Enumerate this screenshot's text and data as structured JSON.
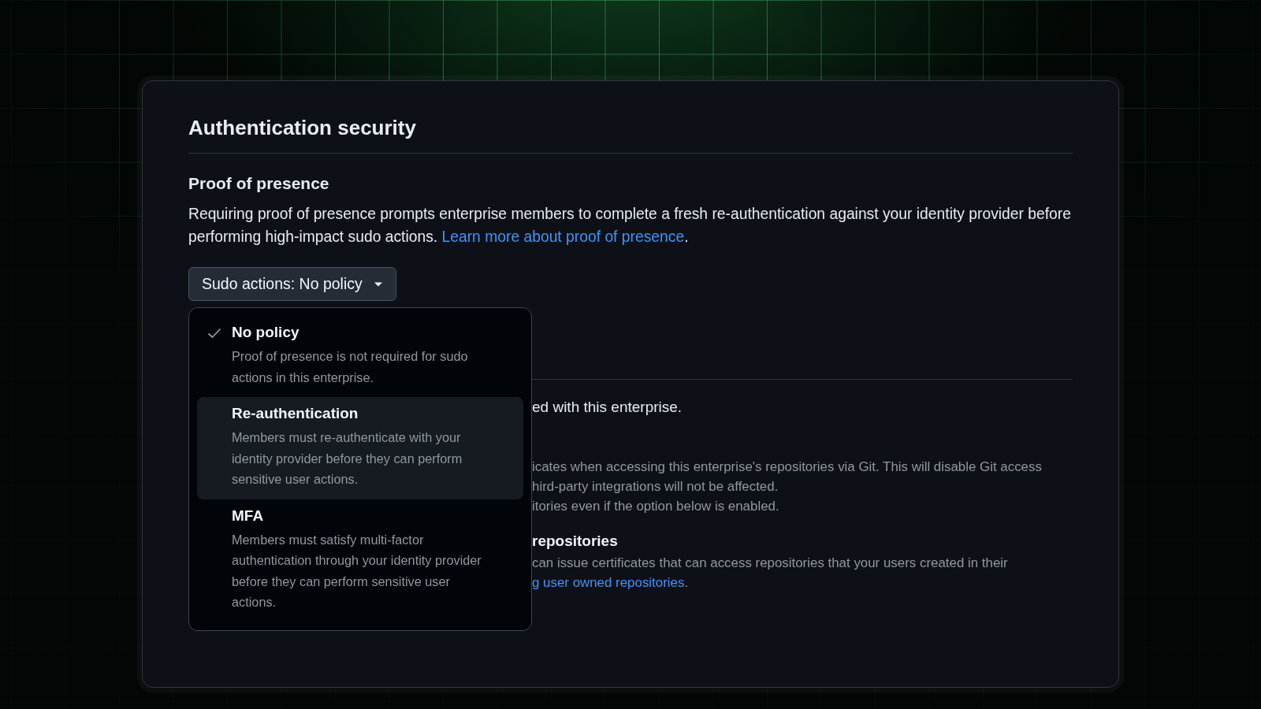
{
  "card": {
    "title": "Authentication security"
  },
  "proof_of_presence": {
    "heading": "Proof of presence",
    "description": "Requiring proof of presence prompts enterprise members to complete a fresh re-authentication against your identity provider before performing high-impact sudo actions.",
    "link": "Learn more about proof of presence",
    "link_suffix": ".",
    "dropdown": {
      "label": "Sudo actions: No policy",
      "expanded": true
    }
  },
  "menu": [
    {
      "title": "No policy",
      "description": "Proof of presence is not required for sudo actions in this enterprise.",
      "selected": true,
      "highlighted": false
    },
    {
      "title": "Re-authentication",
      "description": "Members must re-authenticate with your identity provider before they can perform sensitive user actions.",
      "selected": false,
      "highlighted": true
    },
    {
      "title": "MFA",
      "description": "Members must satisfy multi-factor authentication through your identity provider before they can perform sensitive user actions.",
      "selected": false,
      "highlighted": false
    }
  ],
  "hidden_section": {
    "intro": "ed with this enterprise.",
    "lines": [
      "icates when accessing this enterprise's repositories via Git. This will disable Git access",
      "hird-party integrations will not be affected.",
      "itories even if the option below is enabled."
    ],
    "heading": "repositories",
    "description": "can issue certificates that can access repositories that your users created in their",
    "link": "g user owned repositories",
    "link_suffix": "."
  }
}
